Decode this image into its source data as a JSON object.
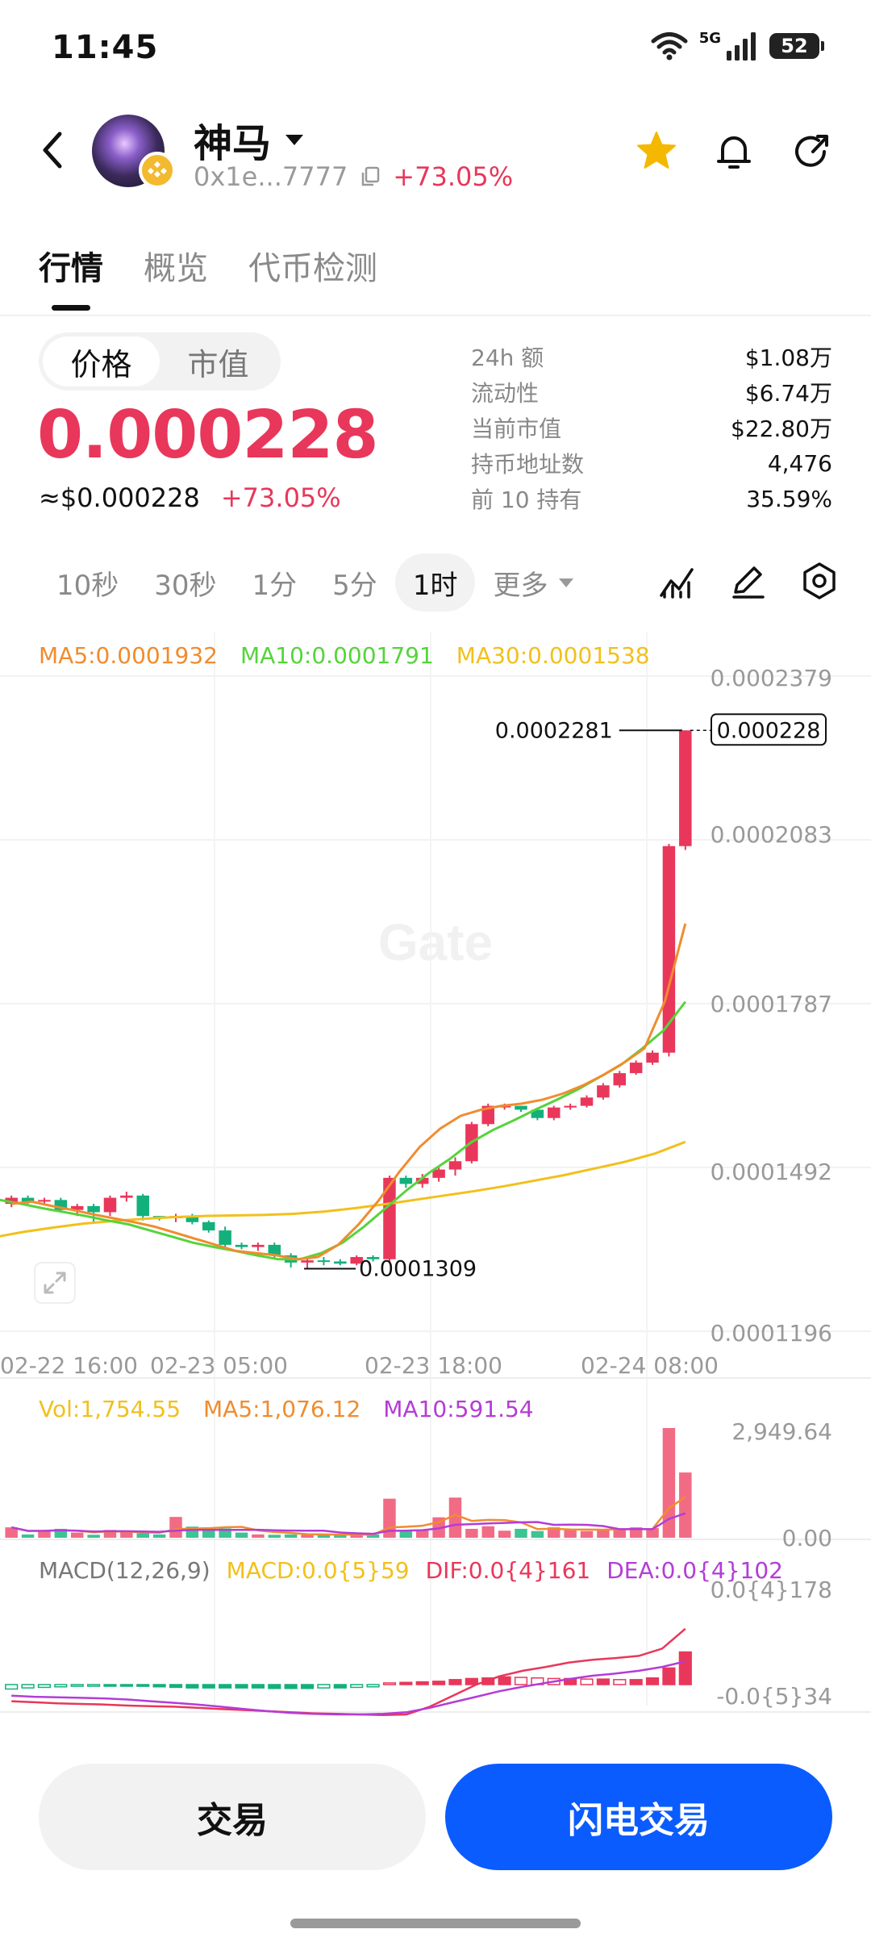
{
  "status": {
    "time": "11:45",
    "net": "5G",
    "battery": "52"
  },
  "header": {
    "name": "神马",
    "address": "0x1e...7777",
    "change": "+73.05%"
  },
  "tabs": [
    "行情",
    "概览",
    "代币检测"
  ],
  "segment": [
    "价格",
    "市值"
  ],
  "price": {
    "main": "0.000228",
    "usd": "≈$0.000228",
    "change": "+73.05%"
  },
  "stats": [
    {
      "label": "24h  额",
      "value": "$1.08万"
    },
    {
      "label": "流动性",
      "value": "$6.74万"
    },
    {
      "label": "当前市值",
      "value": "$22.80万"
    },
    {
      "label": "持币地址数",
      "value": "4,476"
    },
    {
      "label": "前 10 持有",
      "value": "35.59%"
    }
  ],
  "timeframes": [
    "10秒",
    "30秒",
    "1分",
    "5分",
    "1时"
  ],
  "timeframe_more": "更多",
  "ma": {
    "ma5": "MA5:0.0001932",
    "ma10": "MA10:0.0001791",
    "ma30": "MA30:0.0001538"
  },
  "price_axis": [
    "0.0002379",
    "0.0002083",
    "0.0001787",
    "0.0001492",
    "0.0001196"
  ],
  "high_label": "0.0002281",
  "current_label": "0.000228",
  "low_label": "0.0001309",
  "dates": [
    "02-22 16:00",
    "02-23 05:00",
    "02-23 18:00",
    "02-24 08:00"
  ],
  "volume": {
    "vol": "Vol:1,754.55",
    "ma5": "MA5:1,076.12",
    "ma10": "MA10:591.54",
    "max": "2,949.64",
    "min": "0.00"
  },
  "macd": {
    "title": "MACD(12,26,9)",
    "macd": "MACD:0.0{5}59",
    "dif": "DIF:0.0{4}161",
    "dea": "DEA:0.0{4}102",
    "max": "0.0{4}178",
    "min": "-0.0{5}34"
  },
  "watermark": "Gate",
  "buttons": {
    "trade": "交易",
    "flash": "闪电交易"
  },
  "colors": {
    "up": "#e8375a",
    "down": "#13b07c",
    "ma5": "#f08c2e",
    "ma10": "#55d43c",
    "ma30": "#f2c01b",
    "accent": "#0a5cff"
  },
  "chart_data": {
    "type": "candlestick",
    "interval": "1时",
    "ylim": [
      0.0001196,
      0.0002379
    ],
    "high": 0.0002281,
    "low": 0.0001309,
    "last": 0.000228,
    "candles": [
      [
        0.0001426,
        0.0001437,
        0.0001441,
        0.000142
      ],
      [
        0.0001437,
        0.000143,
        0.0001441,
        0.0001426
      ],
      [
        0.000143,
        0.0001433,
        0.0001437,
        0.0001426
      ],
      [
        0.0001433,
        0.0001415,
        0.0001437,
        0.0001411
      ],
      [
        0.0001415,
        0.0001422,
        0.0001426,
        0.0001404
      ],
      [
        0.0001422,
        0.0001411,
        0.0001426,
        0.0001393
      ],
      [
        0.0001411,
        0.0001437,
        0.0001441,
        0.0001404
      ],
      [
        0.0001437,
        0.0001441,
        0.0001448,
        0.000143
      ],
      [
        0.0001441,
        0.0001404,
        0.0001444,
        0.0001396
      ],
      [
        0.0001404,
        0.00014,
        0.0001404,
        0.0001396
      ],
      [
        0.00014,
        0.0001404,
        0.0001408,
        0.0001393
      ],
      [
        0.0001404,
        0.0001393,
        0.0001408,
        0.0001389
      ],
      [
        0.0001393,
        0.0001378,
        0.0001396,
        0.0001374
      ],
      [
        0.0001378,
        0.0001352,
        0.0001385,
        0.0001348
      ],
      [
        0.0001352,
        0.0001348,
        0.0001356,
        0.0001344
      ],
      [
        0.0001348,
        0.0001352,
        0.0001356,
        0.0001341
      ],
      [
        0.0001352,
        0.0001333,
        0.0001356,
        0.0001326
      ],
      [
        0.0001333,
        0.000132,
        0.0001337,
        0.0001311
      ],
      [
        0.000132,
        0.0001324,
        0.000133,
        0.0001309
      ],
      [
        0.0001324,
        0.0001322,
        0.000133,
        0.0001315
      ],
      [
        0.0001322,
        0.0001318,
        0.0001326,
        0.0001315
      ],
      [
        0.0001318,
        0.000133,
        0.0001333,
        0.0001315
      ],
      [
        0.000133,
        0.0001326,
        0.0001333,
        0.0001322
      ],
      [
        0.0001326,
        0.0001473,
        0.0001477,
        0.0001322
      ],
      [
        0.0001473,
        0.0001462,
        0.0001477,
        0.0001455
      ],
      [
        0.0001462,
        0.0001473,
        0.000148,
        0.0001455
      ],
      [
        0.0001473,
        0.0001488,
        0.0001492,
        0.0001466
      ],
      [
        0.0001488,
        0.0001503,
        0.000151,
        0.0001477
      ],
      [
        0.0001503,
        0.000157,
        0.0001574,
        0.0001499
      ],
      [
        0.000157,
        0.0001603,
        0.0001607,
        0.0001566
      ],
      [
        0.0001603,
        0.0001603,
        0.0001607,
        0.0001596
      ],
      [
        0.0001603,
        0.0001596,
        0.0001603,
        0.0001592
      ],
      [
        0.0001596,
        0.0001581,
        0.00016,
        0.0001577
      ],
      [
        0.0001581,
        0.00016,
        0.0001603,
        0.0001577
      ],
      [
        0.00016,
        0.0001603,
        0.0001607,
        0.0001596
      ],
      [
        0.0001603,
        0.0001618,
        0.0001622,
        0.00016
      ],
      [
        0.0001618,
        0.000164,
        0.0001644,
        0.0001614
      ],
      [
        0.000164,
        0.0001662,
        0.0001666,
        0.0001636
      ],
      [
        0.0001662,
        0.0001681,
        0.0001685,
        0.0001659
      ],
      [
        0.0001681,
        0.0001699,
        0.0001703,
        0.0001677
      ],
      [
        0.0001699,
        0.0002072,
        0.0002076,
        0.0001692
      ],
      [
        0.0002072,
        0.0002281,
        0.0002281,
        0.0002065
      ]
    ],
    "ma5": [
      0.0001426,
      0.000143,
      0.0001422,
      0.0001415,
      0.0001407,
      0.00014,
      0.0001393,
      0.0001385,
      0.0001374,
      0.0001363,
      0.0001352,
      0.0001341,
      0.0001337,
      0.0001333,
      0.0001326,
      0.000133,
      0.0001352,
      0.0001389,
      0.0001433,
      0.0001484,
      0.0001529,
      0.0001562,
      0.0001585,
      0.0001596,
      0.0001603,
      0.0001607,
      0.0001614,
      0.0001625,
      0.000164,
      0.0001659,
      0.0001681,
      0.0001707,
      0.0001792,
      0.0001932
    ],
    "ma10": [
      0.0001437,
      0.0001433,
      0.0001426,
      0.0001418,
      0.0001411,
      0.0001404,
      0.0001396,
      0.0001389,
      0.0001378,
      0.0001367,
      0.0001356,
      0.0001348,
      0.0001341,
      0.0001333,
      0.0001326,
      0.0001326,
      0.0001337,
      0.0001356,
      0.0001385,
      0.0001418,
      0.0001451,
      0.0001481,
      0.0001507,
      0.0001537,
      0.0001559,
      0.0001577,
      0.0001596,
      0.0001614,
      0.0001633,
      0.0001655,
      0.0001677,
      0.0001707,
      0.000174,
      0.0001791
    ],
    "ma30": [
      0.0001355,
      0.0001365,
      0.0001375,
      0.0001383,
      0.000139,
      0.0001395,
      0.0001399,
      0.0001402,
      0.0001404,
      0.0001405,
      0.0001406,
      0.0001408,
      0.0001412,
      0.0001418,
      0.0001425,
      0.0001433,
      0.0001441,
      0.0001449,
      0.0001458,
      0.0001468,
      0.0001478,
      0.000149,
      0.0001502,
      0.0001517,
      0.0001538
    ],
    "volume": [
      280,
      90,
      190,
      240,
      140,
      80,
      210,
      170,
      120,
      90,
      560,
      300,
      210,
      250,
      140,
      90,
      80,
      90,
      80,
      100,
      70,
      80,
      90,
      1050,
      180,
      220,
      550,
      1080,
      240,
      310,
      190,
      240,
      180,
      280,
      220,
      180,
      220,
      240,
      280,
      260,
      2949.64,
      1754.55
    ],
    "macd": [
      -8,
      -6,
      -5,
      -4,
      -3,
      -2,
      -2,
      -2,
      -3,
      -4,
      -5,
      -6,
      -6,
      -6,
      -6,
      -6,
      -7,
      -7,
      -7,
      -6,
      -6,
      -5,
      -4,
      3,
      4,
      5,
      6,
      9,
      11,
      12,
      14,
      13,
      12,
      11,
      11,
      10,
      10,
      9,
      9,
      12,
      30,
      59
    ],
    "dif": [
      30,
      28,
      26,
      25,
      24,
      22,
      21,
      20,
      18,
      16,
      14,
      12,
      10,
      8,
      7,
      6,
      5,
      6,
      20,
      40,
      60,
      75,
      85,
      92,
      100,
      105,
      108,
      112,
      125,
      161
    ],
    "dea": [
      40,
      38,
      37,
      36,
      35,
      33,
      30,
      27,
      24,
      20,
      16,
      12,
      9,
      7,
      6,
      6,
      7,
      10,
      18,
      28,
      38,
      48,
      56,
      63,
      70,
      76,
      80,
      85,
      92,
      102
    ]
  }
}
